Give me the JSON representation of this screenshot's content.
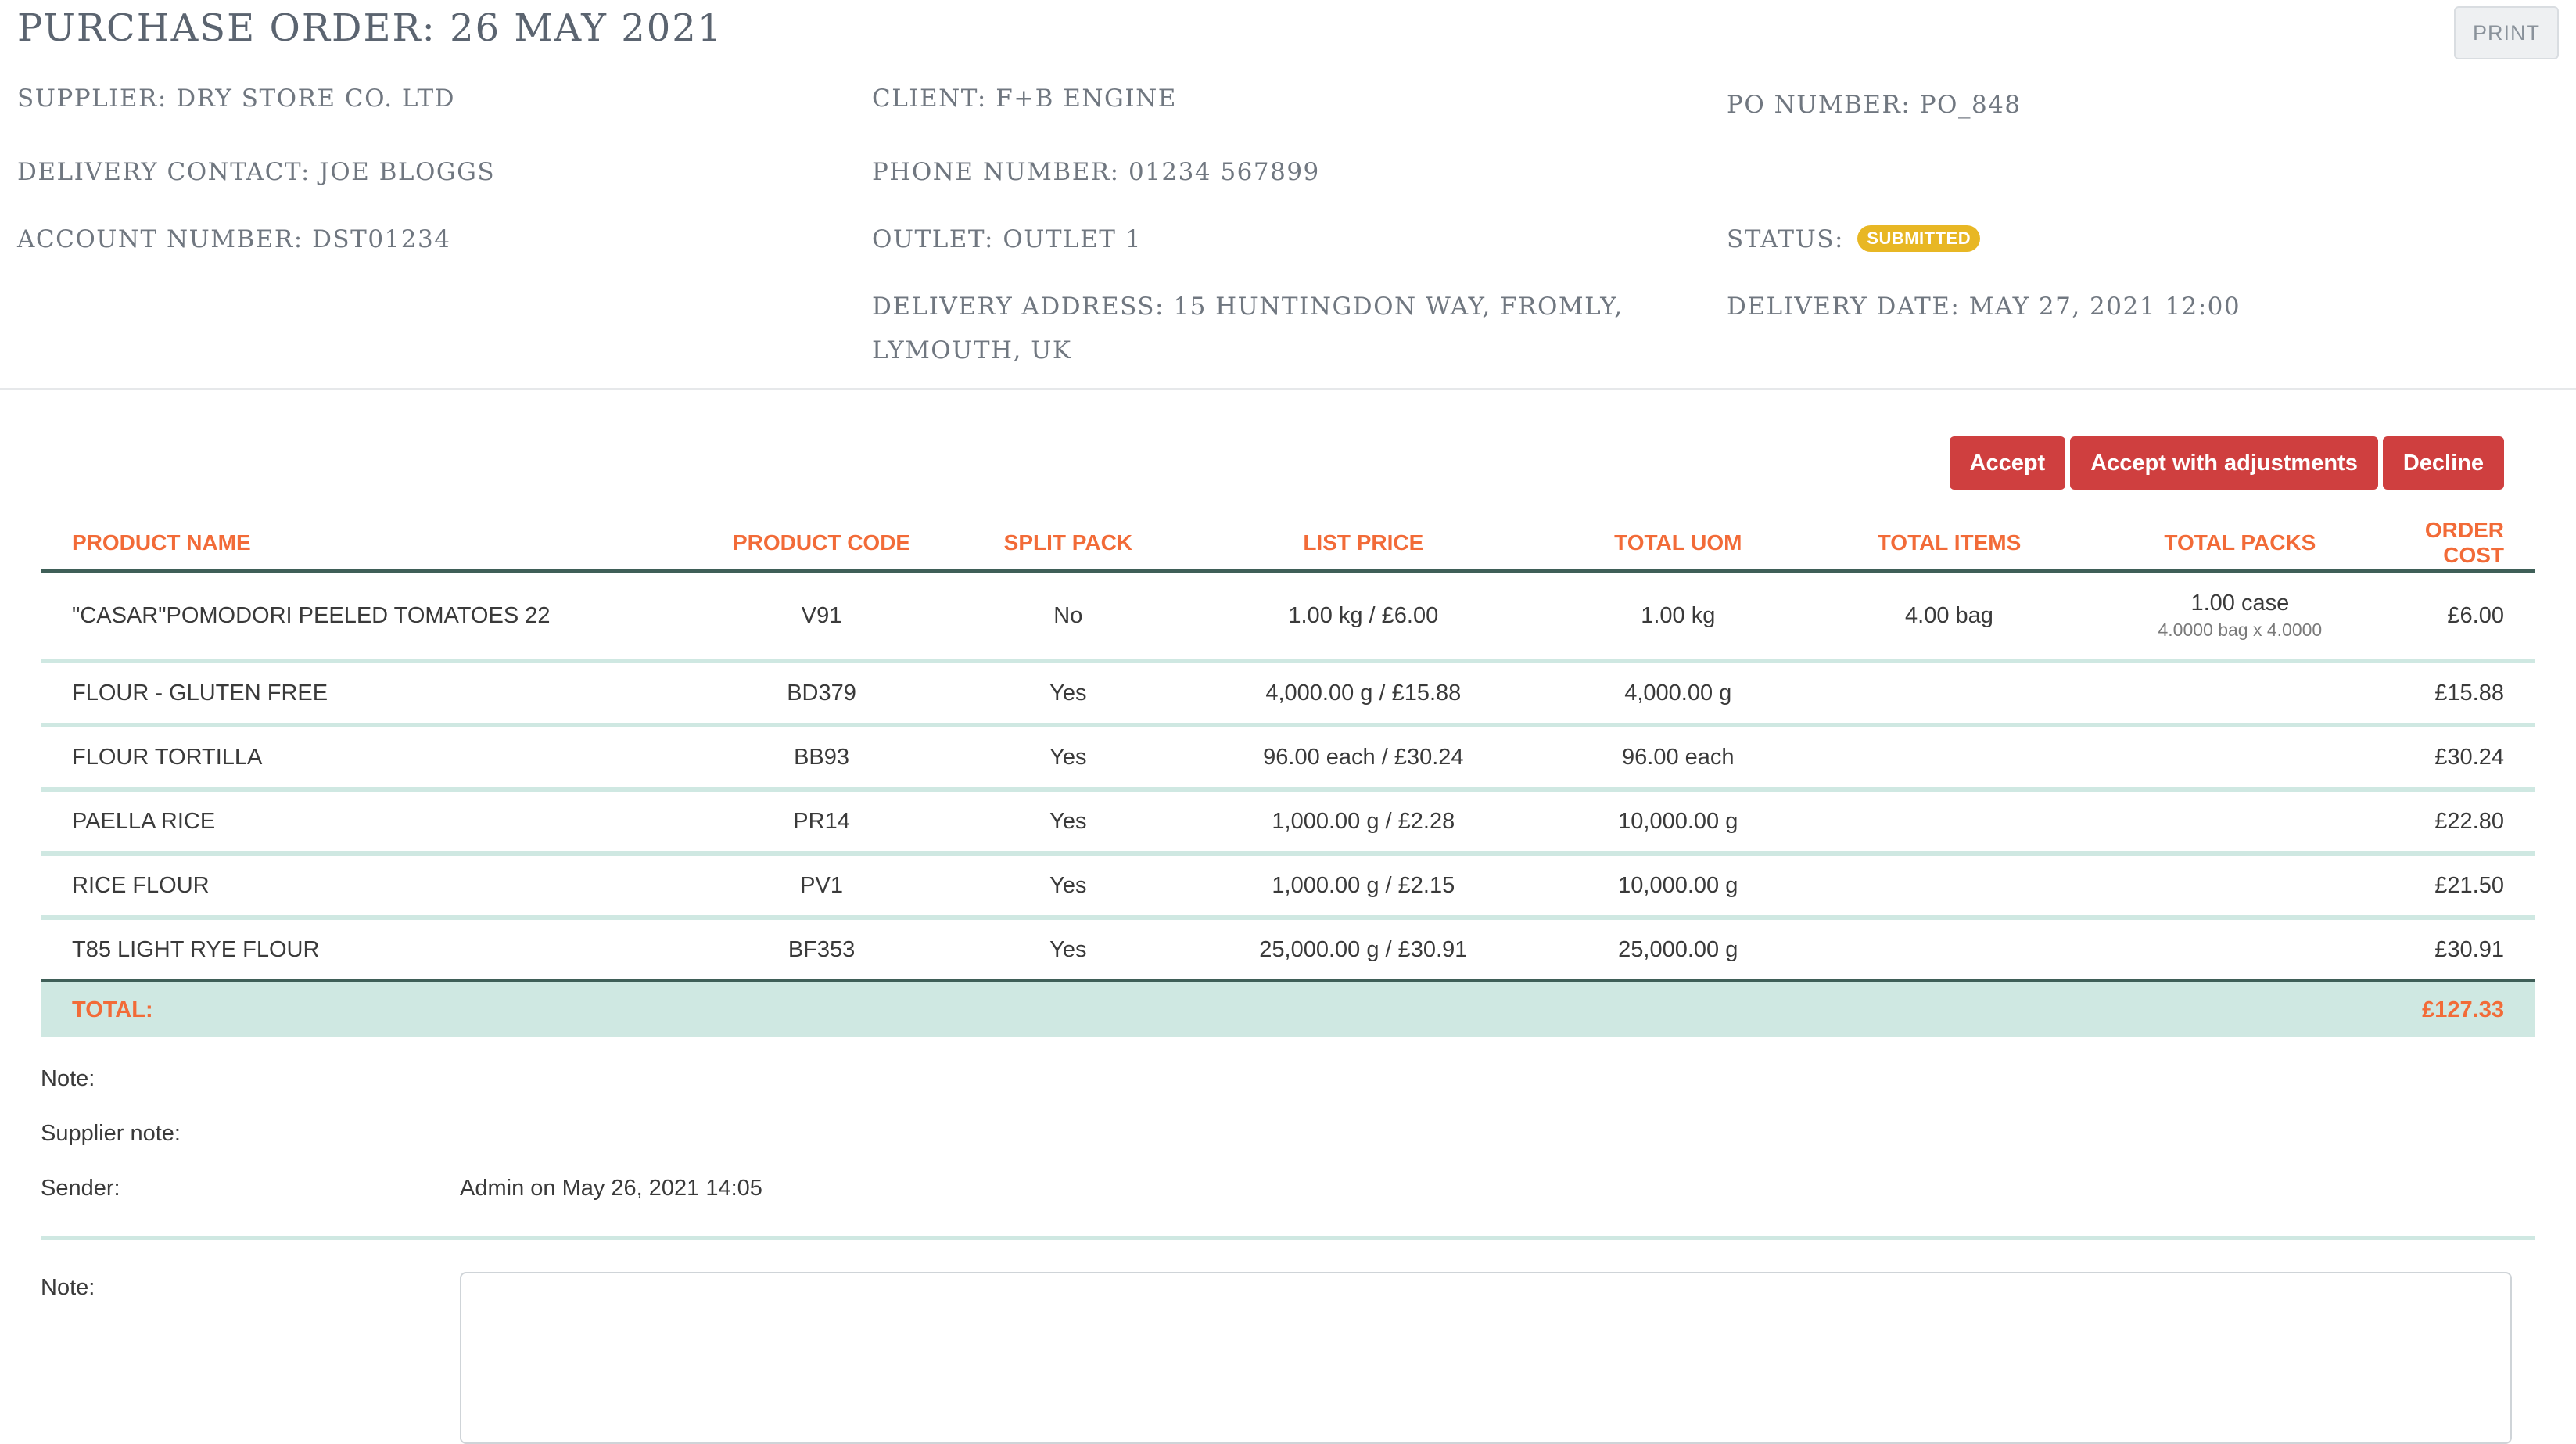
{
  "header": {
    "title": "PURCHASE ORDER: 26 MAY 2021",
    "print_label": "PRINT"
  },
  "info": {
    "supplier": {
      "label": "SUPPLIER:",
      "value": "DRY STORE CO. LTD"
    },
    "client": {
      "label": "CLIENT:",
      "value": "F+B ENGINE"
    },
    "po_number": {
      "label": "PO NUMBER:",
      "value": "PO_848"
    },
    "delivery_contact": {
      "label": "DELIVERY CONTACT:",
      "value": "JOE BLOGGS"
    },
    "phone_number": {
      "label": "PHONE NUMBER:",
      "value": "01234 567899"
    },
    "account_number": {
      "label": "ACCOUNT NUMBER:",
      "value": "DST01234"
    },
    "outlet": {
      "label": "OUTLET:",
      "value": "OUTLET 1"
    },
    "status": {
      "label": "STATUS:",
      "value": "SUBMITTED",
      "color": "#e8b724"
    },
    "delivery_address": {
      "label": "DELIVERY ADDRESS:",
      "line1": "15 HUNTINGDON WAY, FROMLY,",
      "line2": "LYMOUTH, UK"
    },
    "delivery_date": {
      "label": "DELIVERY DATE:",
      "value": "MAY 27, 2021 12:00"
    }
  },
  "actions": {
    "accept": "Accept",
    "accept_adjust": "Accept with adjustments",
    "decline": "Decline",
    "color": "#cf3f3f"
  },
  "table": {
    "headers": [
      "PRODUCT NAME",
      "PRODUCT CODE",
      "SPLIT PACK",
      "LIST PRICE",
      "TOTAL UOM",
      "TOTAL ITEMS",
      "TOTAL PACKS",
      "ORDER COST"
    ],
    "rows": [
      {
        "name": "\"CASAR\"POMODORI PEELED TOMATOES 22",
        "code": "V91",
        "split": "No",
        "price": "1.00 kg / £6.00",
        "uom": "1.00 kg",
        "items": "4.00 bag",
        "packs": "1.00 case",
        "packs_sub": "4.0000 bag x 4.0000",
        "cost": "£6.00"
      },
      {
        "name": "FLOUR - GLUTEN FREE",
        "code": "BD379",
        "split": "Yes",
        "price": "4,000.00 g / £15.88",
        "uom": "4,000.00 g",
        "items": "",
        "packs": "",
        "packs_sub": "",
        "cost": "£15.88"
      },
      {
        "name": "FLOUR TORTILLA",
        "code": "BB93",
        "split": "Yes",
        "price": "96.00 each / £30.24",
        "uom": "96.00 each",
        "items": "",
        "packs": "",
        "packs_sub": "",
        "cost": "£30.24"
      },
      {
        "name": "PAELLA RICE",
        "code": "PR14",
        "split": "Yes",
        "price": "1,000.00 g / £2.28",
        "uom": "10,000.00 g",
        "items": "",
        "packs": "",
        "packs_sub": "",
        "cost": "£22.80"
      },
      {
        "name": "RICE FLOUR",
        "code": "PV1",
        "split": "Yes",
        "price": "1,000.00 g / £2.15",
        "uom": "10,000.00 g",
        "items": "",
        "packs": "",
        "packs_sub": "",
        "cost": "£21.50"
      },
      {
        "name": "T85 LIGHT RYE FLOUR",
        "code": "BF353",
        "split": "Yes",
        "price": "25,000.00 g / £30.91",
        "uom": "25,000.00 g",
        "items": "",
        "packs": "",
        "packs_sub": "",
        "cost": "£30.91"
      }
    ],
    "total_label": "TOTAL:",
    "total_value": "£127.33"
  },
  "notes": {
    "note_label": "Note:",
    "supplier_note_label": "Supplier note:",
    "sender_label": "Sender:",
    "sender_value": "Admin on May 26, 2021 14:05",
    "input_label": "Note:",
    "input_value": ""
  }
}
